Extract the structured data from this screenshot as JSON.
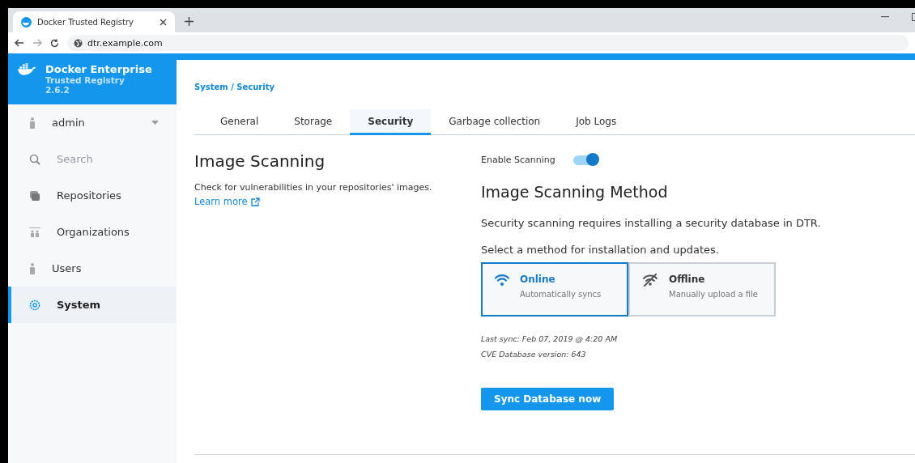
{
  "browser": {
    "tab_title": "Docker Trusted Registry",
    "url": "dtr.example.com"
  },
  "sidebar": {
    "brand": {
      "title": "Docker Enterprise",
      "subtitle": "Trusted Registry",
      "version": "2.6.2"
    },
    "items": [
      {
        "label": "admin",
        "kind": "account",
        "selected": false
      },
      {
        "label": "Search",
        "kind": "search",
        "selected": false
      },
      {
        "label": "Repositories",
        "kind": "link",
        "selected": false
      },
      {
        "label": "Organizations",
        "kind": "link",
        "selected": false
      },
      {
        "label": "Users",
        "kind": "link",
        "selected": false
      },
      {
        "label": "System",
        "kind": "link",
        "selected": true
      }
    ]
  },
  "breadcrumb": "System / Security",
  "tabs": [
    {
      "label": "General",
      "selected": false
    },
    {
      "label": "Storage",
      "selected": false
    },
    {
      "label": "Security",
      "selected": true
    },
    {
      "label": "Garbage collection",
      "selected": false
    },
    {
      "label": "Job Logs",
      "selected": false
    }
  ],
  "scanning": {
    "title": "Image Scanning",
    "description": "Check for vulnerabilities in your repositories' images.",
    "link": "Learn more",
    "toggle": {
      "label": "Enable Scanning",
      "on": true
    },
    "method_title": "Image Scanning Method",
    "info": "Security scanning requires installing a security database in DTR.",
    "prompt": "Select a method for installation and updates.",
    "methods": [
      {
        "kind": "online",
        "label": "Online",
        "sublabel": "Automatically syncs",
        "selected": true
      },
      {
        "kind": "offline",
        "label": "Offline",
        "sublabel": "Manually upload a file",
        "selected": false
      }
    ],
    "last_sync": "Last sync: Feb 07, 2019 @ 4:20 AM",
    "cve_version": "CVE Database version: 643",
    "button": "Sync Database now"
  }
}
